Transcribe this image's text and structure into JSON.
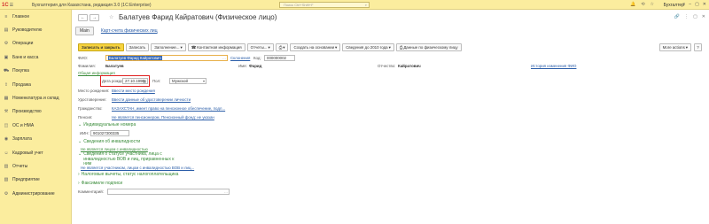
{
  "topbar": {
    "logo": "1С",
    "title": "Бухгалтерия для Казахстана, редакция 3.0   (1С:Enterprise)",
    "search_placeholder": "Поиск Ctrl+Shift+F",
    "user": "Бухгалтер"
  },
  "sidebar": {
    "items": [
      {
        "label": "Главное",
        "icon": "menu-icon"
      },
      {
        "label": "Руководителю",
        "icon": "chart-icon"
      },
      {
        "label": "Операции",
        "icon": "operations-icon"
      },
      {
        "label": "Банк и касса",
        "icon": "bank-icon"
      },
      {
        "label": "Покупка",
        "icon": "cart-icon"
      },
      {
        "label": "Продажа",
        "icon": "sale-icon"
      },
      {
        "label": "Номенклатура и склад",
        "icon": "warehouse-icon"
      },
      {
        "label": "Производство",
        "icon": "production-icon"
      },
      {
        "label": "ОС и НМА",
        "icon": "assets-icon"
      },
      {
        "label": "Зарплата",
        "icon": "salary-icon"
      },
      {
        "label": "Кадровый учет",
        "icon": "hr-icon"
      },
      {
        "label": "Отчеты",
        "icon": "reports-icon"
      },
      {
        "label": "Предприятие",
        "icon": "enterprise-icon"
      },
      {
        "label": "Администрирование",
        "icon": "admin-icon"
      }
    ]
  },
  "header": {
    "title": "Балатуев Фарид Кайратович (Физическое лицо)"
  },
  "tabs": {
    "main": "Main",
    "link": "Карт-счета физических лиц"
  },
  "toolbar": {
    "save_close": "Записать и закрыть",
    "save": "Записать",
    "fill": "Заполнение...",
    "contact": "Контактная информация",
    "reports": "Отчеты...",
    "create_based": "Создать на основании",
    "info2010": "Сведения до 2010 года",
    "data_person": "Данные по физическому лицу",
    "more": "More actions",
    "help": "?"
  },
  "form": {
    "fio_label": "ФИО:",
    "fio_value": "Балатуев Фарид Кайратович",
    "declension": "Склонения",
    "code_label": "Код:",
    "code_value": "000000002",
    "lastname_label": "Фамилия:",
    "lastname_value": "Балатуев",
    "firstname_label": "Имя:",
    "firstname_value": "Фарид",
    "patronymic_label": "Отчество:",
    "patronymic_value": "Кайратович",
    "fio_history": "История изменения ФИО",
    "general_info": "Общая информация",
    "birthdate_label": "Дата рождения:",
    "birthdate_value": "27.10.1990",
    "sex_label": "Пол:",
    "sex_value": "Мужской",
    "birthplace_label": "Место рождения:",
    "birthplace_value": "Ввести место рождения",
    "id_label": "Удостоверение:",
    "id_value": "Ввести данные об удостоверении личности",
    "citizenship_label": "Гражданство:",
    "citizenship_value": "КАЗАХСТАН, имеет право на пенсионное обеспечение, подл...",
    "pension_label": "Пенсия:",
    "pension_value": "Не является пенсионером, Пенсионный фонд: не указан",
    "ids_section": "Индивидуальные номера",
    "iin_label": "ИИН:",
    "iin_value": "901027300335",
    "disability_section": "Сведения об инвалидности",
    "disability_value": "Не является лицом с инвалидностью",
    "status_section": "Сведения о статусе участника, лица с инвалидностью ВОВ и лиц, приравненных к ним",
    "status_value": "Не является участником, лицом с инвалидностью ВОВ и лиц...",
    "tax_section": "Налоговые вычеты, статус налогоплательщика",
    "signature_section": "Факсимиле подписи",
    "comment_label": "Комментарий:"
  }
}
